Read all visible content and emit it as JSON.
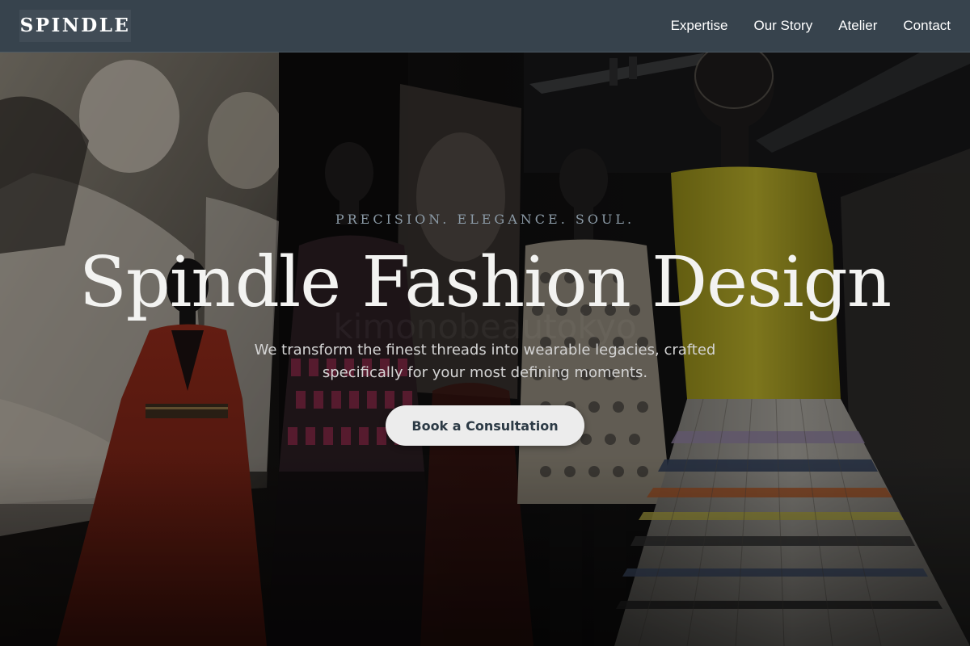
{
  "header": {
    "logo": "SPINDLE",
    "nav": [
      {
        "label": "Expertise"
      },
      {
        "label": "Our Story"
      },
      {
        "label": "Atelier"
      },
      {
        "label": "Contact"
      }
    ]
  },
  "hero": {
    "eyebrow": "PRECISION. ELEGANCE. SOUL.",
    "title": "Spindle Fashion Design",
    "subtitle": "We transform the finest threads into wearable legacies, crafted specifically for your most defining moments.",
    "cta_label": "Book a Consultation",
    "watermark": "kimonobeautokyo"
  },
  "colors": {
    "header_bg": "#37434d",
    "cta_bg": "#ececec",
    "cta_text": "#2c3a45",
    "eyebrow": "#8b9aa6",
    "headline": "#f3f3f1"
  }
}
